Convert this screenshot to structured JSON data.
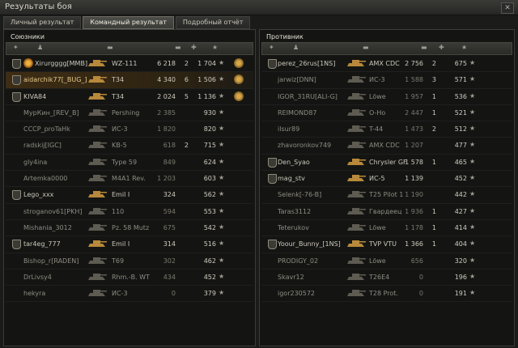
{
  "window": {
    "title": "Результаты боя",
    "close": "✕"
  },
  "tabs": [
    {
      "label": "Личный результат",
      "active": false
    },
    {
      "label": "Командный результат",
      "active": true
    },
    {
      "label": "Подробный отчёт",
      "active": false
    }
  ],
  "allies": {
    "title": "Союзники",
    "players": [
      {
        "name": "Xirurgggg[MMB]",
        "tank": "WZ-111",
        "damage": "6 218",
        "kills": "2",
        "exp": "1 704",
        "badge": true,
        "platoon": true,
        "highlight": false,
        "dead": false,
        "medal": true
      },
      {
        "name": "aidarchik77[_BUG_]",
        "tank": "T34",
        "damage": "4 340",
        "kills": "6",
        "exp": "1 506",
        "badge": true,
        "platoon": false,
        "highlight": true,
        "dead": false,
        "medal": true
      },
      {
        "name": "KIVA84",
        "tank": "T34",
        "damage": "2 024",
        "kills": "5",
        "exp": "1 136",
        "badge": true,
        "platoon": false,
        "highlight": false,
        "dead": false,
        "medal": true
      },
      {
        "name": "МурКин_[REV_B]",
        "tank": "Pershing",
        "damage": "2 385",
        "kills": "",
        "exp": "930",
        "badge": false,
        "highlight": false,
        "dead": true,
        "medal": false
      },
      {
        "name": "CCCP_proTaHk",
        "tank": "ИС-3",
        "damage": "1 820",
        "kills": "",
        "exp": "820",
        "badge": false,
        "highlight": false,
        "dead": true,
        "medal": false
      },
      {
        "name": "radskij[IGC]",
        "tank": "KB-5",
        "damage": "618",
        "kills": "2",
        "exp": "715",
        "badge": false,
        "highlight": false,
        "dead": true,
        "medal": false
      },
      {
        "name": "gly4ina",
        "tank": "Type 59",
        "damage": "849",
        "kills": "",
        "exp": "624",
        "badge": false,
        "highlight": false,
        "dead": true,
        "medal": false
      },
      {
        "name": "Artemka0000",
        "tank": "M4A1 Rev.",
        "damage": "1 203",
        "kills": "",
        "exp": "603",
        "badge": false,
        "highlight": false,
        "dead": true,
        "medal": false
      },
      {
        "name": "Lego_xxx",
        "tank": "Emil I",
        "damage": "324",
        "kills": "",
        "exp": "562",
        "badge": true,
        "highlight": false,
        "dead": false,
        "medal": false
      },
      {
        "name": "stroganov61[PKH]",
        "tank": "110",
        "damage": "594",
        "kills": "",
        "exp": "553",
        "badge": false,
        "highlight": false,
        "dead": true,
        "medal": false
      },
      {
        "name": "Mishania_3012",
        "tank": "Pz. 58 Mutz",
        "damage": "675",
        "kills": "",
        "exp": "542",
        "badge": false,
        "highlight": false,
        "dead": true,
        "medal": false
      },
      {
        "name": "tar4eg_777",
        "tank": "Emil I",
        "damage": "314",
        "kills": "",
        "exp": "516",
        "badge": true,
        "highlight": false,
        "dead": false,
        "medal": false
      },
      {
        "name": "Bishop_r[RADEN]",
        "tank": "T69",
        "damage": "302",
        "kills": "",
        "exp": "462",
        "badge": false,
        "highlight": false,
        "dead": true,
        "medal": false
      },
      {
        "name": "DrLivsy4",
        "tank": "Rhm.-B. WT",
        "damage": "434",
        "kills": "",
        "exp": "452",
        "badge": false,
        "highlight": false,
        "dead": true,
        "medal": false
      },
      {
        "name": "hekyra",
        "tank": "ИС-3",
        "damage": "0",
        "kills": "",
        "exp": "379",
        "badge": false,
        "highlight": false,
        "dead": true,
        "medal": false
      }
    ]
  },
  "enemies": {
    "title": "Противник",
    "players": [
      {
        "name": "perez_26rus[1NS]",
        "tank": "AMX CDC",
        "damage": "2 756",
        "kills": "2",
        "exp": "675",
        "badge": true,
        "highlight": false,
        "dead": false
      },
      {
        "name": "jarwiz[DNN]",
        "tank": "ИС-3",
        "damage": "1 588",
        "kills": "3",
        "exp": "571",
        "badge": false,
        "highlight": false,
        "dead": true
      },
      {
        "name": "IGOR_31RU[ALI-G]",
        "tank": "Löwe",
        "damage": "1 957",
        "kills": "1",
        "exp": "536",
        "badge": false,
        "highlight": false,
        "dead": true
      },
      {
        "name": "REIMOND87",
        "tank": "O-Ho",
        "damage": "2 447",
        "kills": "1",
        "exp": "521",
        "badge": false,
        "highlight": false,
        "dead": true
      },
      {
        "name": "ilsur89",
        "tank": "T-44",
        "damage": "1 473",
        "kills": "2",
        "exp": "512",
        "badge": false,
        "highlight": false,
        "dead": true
      },
      {
        "name": "zhavoronkov749",
        "tank": "AMX CDC",
        "damage": "1 207",
        "kills": "",
        "exp": "477",
        "badge": false,
        "highlight": false,
        "dead": true
      },
      {
        "name": "Den_Syao",
        "tank": "Chrysler GF",
        "damage": "1 578",
        "kills": "1",
        "exp": "465",
        "badge": true,
        "highlight": false,
        "dead": false
      },
      {
        "name": "mag_stv",
        "tank": "ИС-5",
        "damage": "1 139",
        "kills": "",
        "exp": "452",
        "badge": true,
        "highlight": false,
        "dead": false
      },
      {
        "name": "Selenk[-76-B]",
        "tank": "T25 Pilot 1",
        "damage": "1 190",
        "kills": "",
        "exp": "442",
        "badge": false,
        "highlight": false,
        "dead": true
      },
      {
        "name": "Taras3112",
        "tank": "Гвардеец",
        "damage": "1 936",
        "kills": "1",
        "exp": "427",
        "badge": false,
        "highlight": false,
        "dead": true
      },
      {
        "name": "Teterukov",
        "tank": "Löwe",
        "damage": "1 178",
        "kills": "1",
        "exp": "414",
        "badge": false,
        "highlight": false,
        "dead": true
      },
      {
        "name": "Yoour_Bunny_[1NS]",
        "tank": "TVP VTU",
        "damage": "1 366",
        "kills": "1",
        "exp": "404",
        "badge": true,
        "highlight": false,
        "dead": false
      },
      {
        "name": "PRODIGY_02",
        "tank": "Löwe",
        "damage": "656",
        "kills": "",
        "exp": "320",
        "badge": false,
        "highlight": false,
        "dead": true
      },
      {
        "name": "Skavr12",
        "tank": "T26E4",
        "damage": "0",
        "kills": "",
        "exp": "196",
        "badge": false,
        "highlight": false,
        "dead": true
      },
      {
        "name": "igor230572",
        "tank": "T28 Prot.",
        "damage": "0",
        "kills": "",
        "exp": "191",
        "badge": false,
        "highlight": false,
        "dead": true
      }
    ]
  },
  "icons": {
    "badge": "shield-badge-icon",
    "platoon": "platoon-icon",
    "player": "player-icon",
    "tank": "tank-silhouette-icon",
    "damage": "damage-icon",
    "kills": "kills-icon",
    "exp": "star-icon"
  },
  "colors": {
    "highlight_row": "#3e2d14",
    "medal": "#d6a84b"
  },
  "glyphs": {
    "star": "★",
    "player": "♟",
    "badge": "✦",
    "damage": "▬",
    "kills": "✚"
  }
}
